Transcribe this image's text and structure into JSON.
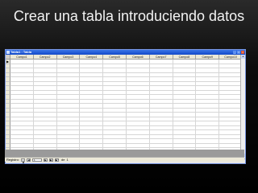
{
  "slide": {
    "title": "Crear una tabla introduciendo datos"
  },
  "window": {
    "title": "Tabla1 : Tabla",
    "controls": [
      "_",
      "□",
      "×"
    ]
  },
  "table": {
    "columns": [
      "Campo1",
      "Campo2",
      "Campo3",
      "Campo4",
      "Campo5",
      "Campo6",
      "Campo7",
      "Campo8",
      "Campo9",
      "Campo10"
    ],
    "active_row_marker": "▶"
  },
  "record_nav": {
    "label": "Registro:",
    "first": "|◀",
    "prev": "◀",
    "current": "1",
    "next": "▶",
    "last": "▶|",
    "new": "▶*",
    "of_label": "de",
    "total": "1"
  },
  "colors": {
    "titlebar": "#1f5fdc",
    "grid_bg": "#ffffff",
    "workspace": "#9a9a9a"
  }
}
